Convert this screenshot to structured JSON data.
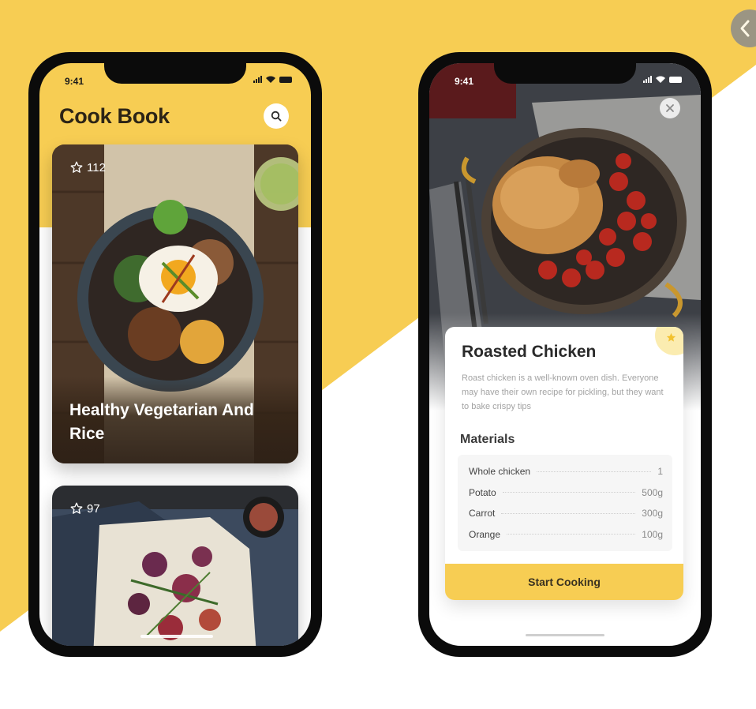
{
  "colors": {
    "accent": "#f7cd53",
    "dark": "#0b0b0b"
  },
  "left_phone": {
    "status_time": "9:41",
    "app_title": "Cook Book",
    "icons": {
      "search": "search-icon",
      "star": "star-outline-icon"
    },
    "cards": [
      {
        "rating": "112",
        "title": "Healthy Vegetarian And Rice"
      },
      {
        "rating": "97",
        "title": ""
      }
    ]
  },
  "right_phone": {
    "status_time": "9:41",
    "icons": {
      "close": "close-icon",
      "favorite": "star-filled-icon"
    },
    "recipe_title": "Roasted Chicken",
    "description": "Roast chicken is a well-known oven dish. Everyone may have their own recipe for pickling, but they want to bake crispy tips",
    "materials_title": "Materials",
    "materials": [
      {
        "name": "Whole chicken",
        "qty": "1"
      },
      {
        "name": "Potato",
        "qty": "500g"
      },
      {
        "name": "Carrot",
        "qty": "300g"
      },
      {
        "name": "Orange",
        "qty": "100g"
      }
    ],
    "start_button": "Start Cooking"
  }
}
